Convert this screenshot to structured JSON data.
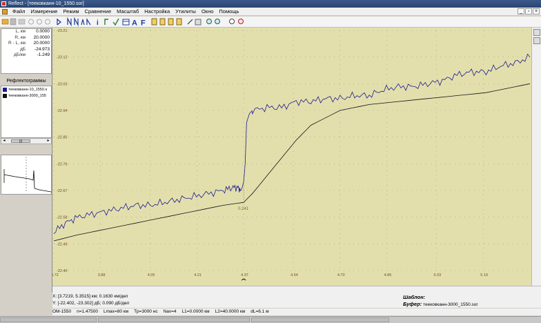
{
  "window": {
    "title": "Reflect - [теековканн-10_1550.sor]"
  },
  "menu": [
    "Файл",
    "Измерение",
    "Режим",
    "Сравнение",
    "Масштаб",
    "Настройка",
    "Утилиты",
    "Окно",
    "Помощь"
  ],
  "measurements": [
    {
      "label": "L, км",
      "value": "0.0000"
    },
    {
      "label": "R, км",
      "value": "20.0000"
    },
    {
      "label": "R - L, км",
      "value": "20.0000"
    },
    {
      "label": "дБ",
      "value": "-24.973"
    },
    {
      "label": "дБ/км",
      "value": "-1.249"
    }
  ],
  "traces_panel": {
    "title": "Рефлектограммы",
    "items": [
      {
        "name": "теековканн-10_1550.s",
        "color": "#1c1a8c"
      },
      {
        "name": "теековканн-3000_155",
        "color": "#111111"
      }
    ]
  },
  "chart_data": {
    "type": "line",
    "xlabel": "",
    "ylabel": "",
    "xlim": [
      3.72,
      5.35
    ],
    "ylim": [
      -23.21,
      -22.4
    ],
    "x_ticks": [
      "3.72",
      "3.88",
      "4.05",
      "4.21",
      "4.37",
      "4.54",
      "4.70",
      "4.86",
      "5.03",
      "5.19"
    ],
    "y_ticks": [
      "-22.40",
      "-22.49",
      "-22.58",
      "-22.67",
      "-22.76",
      "-22.85",
      "-22.94",
      "-23.03",
      "-23.12",
      "-23.21"
    ],
    "grid": true,
    "series": [
      {
        "name": "теековканн-10_1550.s",
        "color": "#1c1a8c",
        "x": [
          3.72,
          3.76,
          3.8,
          3.85,
          3.9,
          3.95,
          4.0,
          4.05,
          4.1,
          4.15,
          4.2,
          4.25,
          4.3,
          4.33,
          4.35,
          4.36,
          4.365,
          4.37,
          4.375,
          4.38,
          4.39,
          4.4,
          4.45,
          4.5,
          4.55,
          4.6,
          4.65,
          4.7,
          4.75,
          4.8,
          4.85,
          4.9,
          4.95,
          5.0,
          5.05,
          5.1,
          5.15,
          5.2,
          5.25,
          5.3,
          5.35
        ],
        "y": [
          -22.53,
          -22.56,
          -22.58,
          -22.59,
          -22.6,
          -22.61,
          -22.62,
          -22.62,
          -22.63,
          -22.64,
          -22.65,
          -22.66,
          -22.67,
          -22.68,
          -22.68,
          -22.67,
          -22.68,
          -22.7,
          -22.76,
          -22.9,
          -22.93,
          -22.94,
          -22.95,
          -22.95,
          -22.97,
          -22.97,
          -22.98,
          -22.98,
          -22.99,
          -22.99,
          -23.01,
          -23.02,
          -23.02,
          -23.03,
          -23.04,
          -23.06,
          -23.07,
          -23.07,
          -23.09,
          -23.1,
          -23.12
        ]
      },
      {
        "name": "теековканн-3000_155",
        "color": "#111111",
        "x": [
          3.72,
          3.8,
          3.9,
          4.0,
          4.1,
          4.2,
          4.3,
          4.37,
          4.4,
          4.45,
          4.5,
          4.55,
          4.6,
          4.7,
          4.8,
          4.9,
          5.0,
          5.1,
          5.2,
          5.3,
          5.35
        ],
        "y": [
          -22.5,
          -22.52,
          -22.54,
          -22.56,
          -22.58,
          -22.6,
          -22.62,
          -22.63,
          -22.66,
          -22.72,
          -22.78,
          -22.84,
          -22.89,
          -22.94,
          -22.96,
          -22.97,
          -22.98,
          -22.99,
          -23.0,
          -23.02,
          -23.03
        ]
      }
    ],
    "annotations": [
      {
        "text": "0.241",
        "x": 4.37,
        "y": -22.61
      }
    ]
  },
  "status": {
    "x_line": "X: [3.7219, 5.3515] км; 0.1630 км/дел",
    "y_line": "Y: [-22.402, -23.302] дБ; 0.090 дБ/дел",
    "template_label": "Шаблон:",
    "buffer_label": "Буфер:",
    "buffer_value": "теековканн-3000_1550.sor",
    "wavelength": "ОМ-1550",
    "n": "n=1.47500",
    "lmax": "Lmax=80 км",
    "tp": "Tp=3000 нс",
    "nav": "Nav=4",
    "l1": "L1=0.0000 км",
    "l2": "L2=40.0000 км",
    "dl": "dL=6.1 м"
  }
}
